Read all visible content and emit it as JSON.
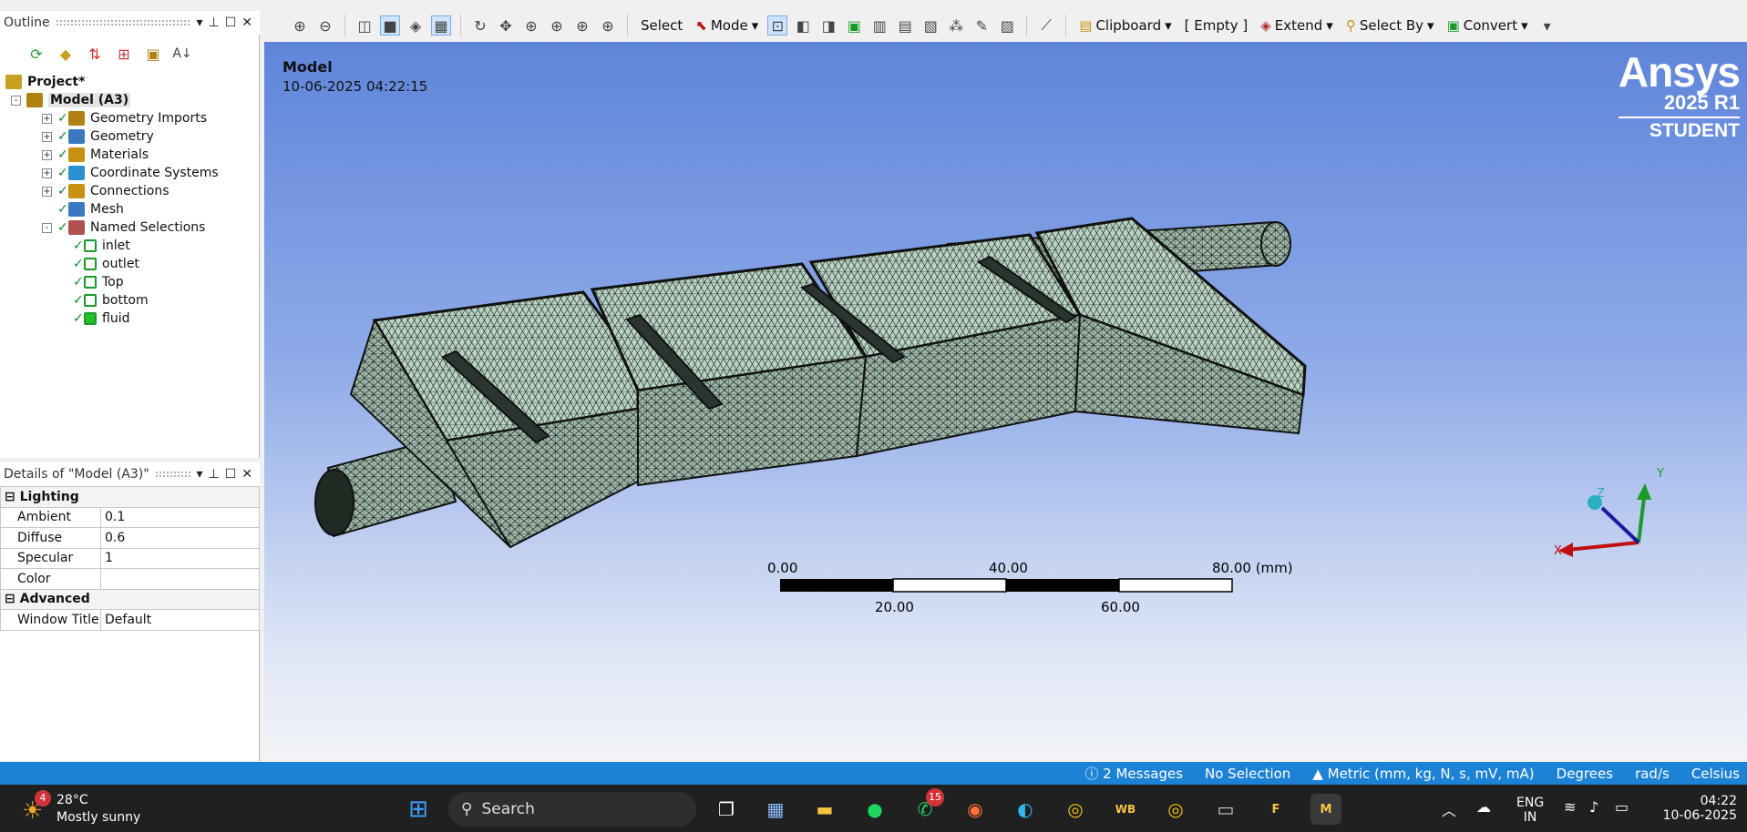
{
  "outline": {
    "title": "Outline",
    "tree": [
      {
        "label": "Project*",
        "level": 0,
        "bold": true,
        "icon": "project-icon"
      },
      {
        "label": "Model (A3)",
        "level": 1,
        "bold": true,
        "icon": "model-icon",
        "expander": "-"
      },
      {
        "label": "Geometry Imports",
        "level": 2,
        "icon": "geometry-imports-icon",
        "expander": "+"
      },
      {
        "label": "Geometry",
        "level": 2,
        "icon": "geometry-icon",
        "expander": "+"
      },
      {
        "label": "Materials",
        "level": 2,
        "icon": "materials-icon",
        "expander": "+"
      },
      {
        "label": "Coordinate Systems",
        "level": 2,
        "icon": "coordinate-systems-icon",
        "expander": "+"
      },
      {
        "label": "Connections",
        "level": 2,
        "icon": "connections-icon",
        "expander": "+"
      },
      {
        "label": "Mesh",
        "level": 2,
        "icon": "mesh-icon",
        "expander": ""
      },
      {
        "label": "Named Selections",
        "level": 2,
        "icon": "named-selections-icon",
        "expander": "-"
      },
      {
        "label": "inlet",
        "level": 3,
        "icon": "named-selection-icon"
      },
      {
        "label": "outlet",
        "level": 3,
        "icon": "named-selection-icon"
      },
      {
        "label": "Top",
        "level": 3,
        "icon": "named-selection-icon"
      },
      {
        "label": "bottom",
        "level": 3,
        "icon": "named-selection-icon"
      },
      {
        "label": "fluid",
        "level": 3,
        "icon": "body-selection-icon"
      }
    ]
  },
  "details": {
    "title": "Details of \"Model (A3)\"",
    "groups": [
      {
        "name": "Lighting",
        "rows": [
          [
            "Ambient",
            "0.1"
          ],
          [
            "Diffuse",
            "0.6"
          ],
          [
            "Specular",
            "1"
          ],
          [
            "Color",
            ""
          ]
        ]
      },
      {
        "name": "Advanced",
        "rows": [
          [
            "Window Title",
            "Default"
          ]
        ]
      }
    ]
  },
  "toolbar": {
    "select_label": "Select",
    "mode_label": "Mode",
    "clipboard_label": "Clipboard",
    "empty_label": "[ Empty ]",
    "extend_label": "Extend",
    "select_by_label": "Select By",
    "convert_label": "Convert"
  },
  "viewport": {
    "title": "Model",
    "datetime": "10-06-2025 04:22:15",
    "brand": {
      "name": "Ansys",
      "version": "2025 R1",
      "edition": "STUDENT"
    },
    "scale": {
      "top_labels": [
        "0.00",
        "40.00",
        "80.00 (mm)"
      ],
      "bottom_labels": [
        "20.00",
        "60.00"
      ]
    },
    "triad": {
      "x": "X",
      "y": "Y",
      "z": "Z"
    },
    "mesh_color": "#b9d4c3"
  },
  "status": {
    "messages": "2 Messages",
    "selection": "No Selection",
    "units": "Metric (mm, kg, N, s, mV, mA)",
    "angle": "Degrees",
    "rate": "rad/s",
    "temperature": "Celsius"
  },
  "taskbar": {
    "weather_temp": "28°C",
    "weather_desc": "Mostly sunny",
    "weather_badge": "4",
    "search_label": "Search",
    "whatsapp_badge": "15",
    "wb_label": "WB",
    "f_label": "F",
    "m_label": "M",
    "lang": "ENG",
    "region": "IN",
    "time": "04:22",
    "date": "10-06-2025"
  },
  "accent": "#1c82d6"
}
